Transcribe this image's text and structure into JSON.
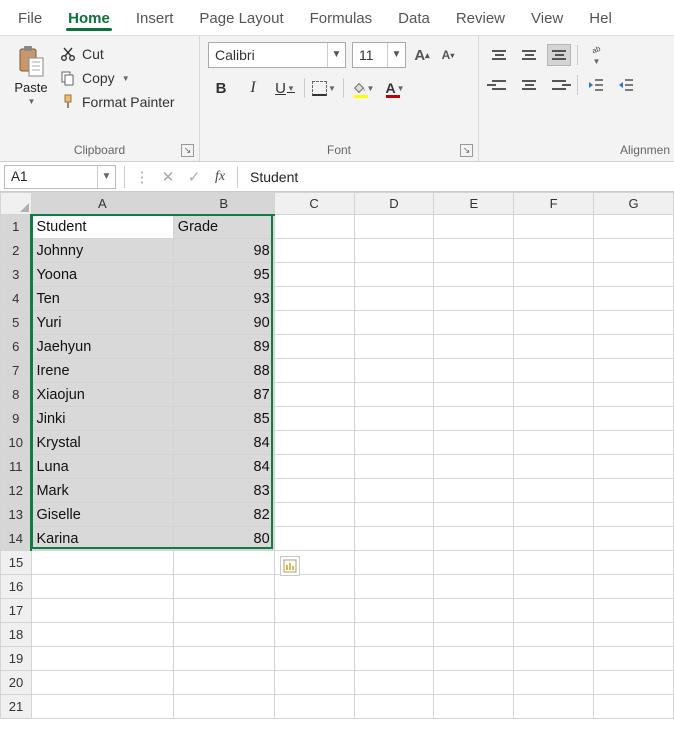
{
  "tabs": [
    "File",
    "Home",
    "Insert",
    "Page Layout",
    "Formulas",
    "Data",
    "Review",
    "View",
    "Hel"
  ],
  "active_tab": "Home",
  "ribbon": {
    "clipboard": {
      "paste": "Paste",
      "cut": "Cut",
      "copy": "Copy",
      "format_painter": "Format Painter",
      "group_label": "Clipboard"
    },
    "font": {
      "name": "Calibri",
      "size": "11",
      "group_label": "Font",
      "fill_color": "#ffff00",
      "font_color": "#c00000"
    },
    "alignment": {
      "group_label": "Alignmen"
    }
  },
  "formula_bar": {
    "name_box": "A1",
    "formula": "Student"
  },
  "columns": [
    "A",
    "B",
    "C",
    "D",
    "E",
    "F",
    "G"
  ],
  "selected_cols": [
    "A",
    "B"
  ],
  "selected_rows_max": 14,
  "active_cell": "A1",
  "chart_data": {
    "type": "table",
    "headers": [
      "Student",
      "Grade"
    ],
    "rows": [
      {
        "student": "Johnny",
        "grade": 98
      },
      {
        "student": "Yoona",
        "grade": 95
      },
      {
        "student": "Ten",
        "grade": 93
      },
      {
        "student": "Yuri",
        "grade": 90
      },
      {
        "student": "Jaehyun",
        "grade": 89
      },
      {
        "student": "Irene",
        "grade": 88
      },
      {
        "student": "Xiaojun",
        "grade": 87
      },
      {
        "student": "Jinki",
        "grade": 85
      },
      {
        "student": "Krystal",
        "grade": 84
      },
      {
        "student": "Luna",
        "grade": 84
      },
      {
        "student": "Mark",
        "grade": 83
      },
      {
        "student": "Giselle",
        "grade": 82
      },
      {
        "student": "Karina",
        "grade": 80
      }
    ]
  },
  "total_rows": 21
}
